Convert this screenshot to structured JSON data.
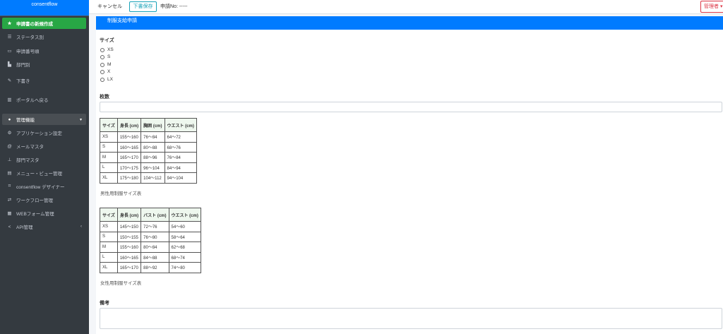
{
  "sidebar": {
    "brand": "consentflow",
    "items": [
      {
        "label": "申請書の新規作成",
        "icon": "star-icon"
      },
      {
        "label": "ステータス別",
        "icon": "list-icon"
      },
      {
        "label": "申請番号順",
        "icon": "inbox-icon"
      },
      {
        "label": "部門別",
        "icon": "bar-chart-icon"
      },
      {
        "label": "下書き",
        "icon": "edit-icon"
      },
      {
        "label": "ポータルへ戻る",
        "icon": "building-icon"
      },
      {
        "label": "管理機能",
        "icon": "users-cog-icon"
      },
      {
        "label": "アプリケーション設定",
        "icon": "gear-icon"
      },
      {
        "label": "メールマスタ",
        "icon": "at-icon"
      },
      {
        "label": "部門マスタ",
        "icon": "sitemap-icon"
      },
      {
        "label": "メニュー・ビュー管理",
        "icon": "window-icon"
      },
      {
        "label": "consentflow デザイナー",
        "icon": "project-diagram-icon"
      },
      {
        "label": "ワークフロー管理",
        "icon": "workflow-icon"
      },
      {
        "label": "WEBフォーム管理",
        "icon": "form-icon"
      },
      {
        "label": "API管理",
        "icon": "share-icon"
      }
    ]
  },
  "topbar": {
    "cancel": "キャンセル",
    "draft": "下書保存",
    "app_no": "申請No: -----",
    "admin": "管理者 ▾"
  },
  "form": {
    "title": "制服支給申請",
    "size_label": "サイズ",
    "size_options": [
      "XS",
      "S",
      "M",
      "X",
      "LX"
    ],
    "count_label": "枚数",
    "notes_label": "備考"
  },
  "men_table": {
    "caption": "男性用制服サイズ表",
    "headers": [
      "サイズ",
      "身長 (cm)",
      "胸囲 (cm)",
      "ウエスト (cm)"
    ],
    "rows": [
      [
        "XS",
        "155〜160",
        "76〜84",
        "64〜72"
      ],
      [
        "S",
        "160〜165",
        "80〜88",
        "68〜76"
      ],
      [
        "M",
        "165〜170",
        "88〜96",
        "76〜84"
      ],
      [
        "L",
        "170〜175",
        "96〜104",
        "84〜94"
      ],
      [
        "XL",
        "175〜180",
        "104〜112",
        "94〜104"
      ]
    ]
  },
  "women_table": {
    "caption": "女性用制服サイズ表",
    "headers": [
      "サイズ",
      "身長 (cm)",
      "バスト (cm)",
      "ウエスト (cm)"
    ],
    "rows": [
      [
        "XS",
        "145〜150",
        "72〜76",
        "54〜60"
      ],
      [
        "S",
        "150〜155",
        "76〜80",
        "58〜64"
      ],
      [
        "M",
        "155〜160",
        "80〜84",
        "62〜68"
      ],
      [
        "L",
        "160〜165",
        "84〜88",
        "68〜74"
      ],
      [
        "XL",
        "165〜170",
        "88〜92",
        "74〜80"
      ]
    ]
  }
}
